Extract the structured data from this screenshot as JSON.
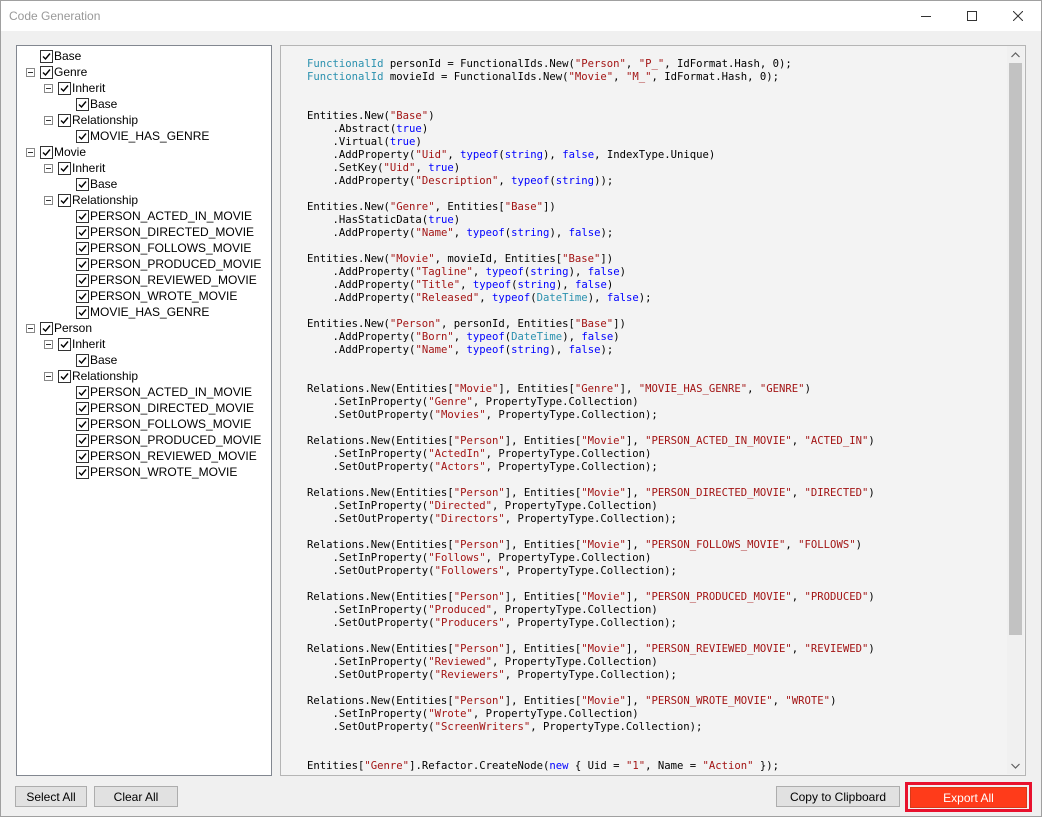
{
  "window": {
    "title": "Code Generation",
    "controls": [
      "minimize-icon",
      "maximize-icon",
      "close-icon"
    ]
  },
  "tree": [
    {
      "label": "Base",
      "checked": true,
      "expander": false
    },
    {
      "label": "Genre",
      "checked": true,
      "expander": true
    },
    {
      "label": "Inherit",
      "checked": true,
      "expander": true
    },
    {
      "label": "Base",
      "checked": true,
      "expander": false
    },
    {
      "label": "Relationship",
      "checked": true,
      "expander": true
    },
    {
      "label": "MOVIE_HAS_GENRE",
      "checked": true,
      "expander": false
    },
    {
      "label": "Movie",
      "checked": true,
      "expander": true
    },
    {
      "label": "Inherit",
      "checked": true,
      "expander": true
    },
    {
      "label": "Base",
      "checked": true,
      "expander": false
    },
    {
      "label": "Relationship",
      "checked": true,
      "expander": true
    },
    {
      "label": "PERSON_ACTED_IN_MOVIE",
      "checked": true,
      "expander": false
    },
    {
      "label": "PERSON_DIRECTED_MOVIE",
      "checked": true,
      "expander": false
    },
    {
      "label": "PERSON_FOLLOWS_MOVIE",
      "checked": true,
      "expander": false
    },
    {
      "label": "PERSON_PRODUCED_MOVIE",
      "checked": true,
      "expander": false
    },
    {
      "label": "PERSON_REVIEWED_MOVIE",
      "checked": true,
      "expander": false
    },
    {
      "label": "PERSON_WROTE_MOVIE",
      "checked": true,
      "expander": false
    },
    {
      "label": "MOVIE_HAS_GENRE",
      "checked": true,
      "expander": false
    },
    {
      "label": "Person",
      "checked": true,
      "expander": true
    },
    {
      "label": "Inherit",
      "checked": true,
      "expander": true
    },
    {
      "label": "Base",
      "checked": true,
      "expander": false
    },
    {
      "label": "Relationship",
      "checked": true,
      "expander": true
    },
    {
      "label": "PERSON_ACTED_IN_MOVIE",
      "checked": true,
      "expander": false
    },
    {
      "label": "PERSON_DIRECTED_MOVIE",
      "checked": true,
      "expander": false
    },
    {
      "label": "PERSON_FOLLOWS_MOVIE",
      "checked": true,
      "expander": false
    },
    {
      "label": "PERSON_PRODUCED_MOVIE",
      "checked": true,
      "expander": false
    },
    {
      "label": "PERSON_REVIEWED_MOVIE",
      "checked": true,
      "expander": false
    },
    {
      "label": "PERSON_WROTE_MOVIE",
      "checked": true,
      "expander": false
    }
  ],
  "code_colors": {
    "type": "#2b91af",
    "string": "#a31515",
    "keyword": "#0000ff",
    "default": "#000000"
  },
  "code": [
    [
      [
        "t",
        "FunctionalId"
      ],
      [
        "p",
        " personId = FunctionalIds.New("
      ],
      [
        "s",
        "\"Person\""
      ],
      [
        "p",
        ", "
      ],
      [
        "s",
        "\"P_\""
      ],
      [
        "p",
        ", IdFormat.Hash, 0);"
      ]
    ],
    [
      [
        "t",
        "FunctionalId"
      ],
      [
        "p",
        " movieId = FunctionalIds.New("
      ],
      [
        "s",
        "\"Movie\""
      ],
      [
        "p",
        ", "
      ],
      [
        "s",
        "\"M_\""
      ],
      [
        "p",
        ", IdFormat.Hash, 0);"
      ]
    ],
    [],
    [],
    [
      [
        "p",
        "Entities.New("
      ],
      [
        "s",
        "\"Base\""
      ],
      [
        "p",
        ")"
      ]
    ],
    [
      [
        "p",
        "    .Abstract("
      ],
      [
        "k",
        "true"
      ],
      [
        "p",
        ")"
      ]
    ],
    [
      [
        "p",
        "    .Virtual("
      ],
      [
        "k",
        "true"
      ],
      [
        "p",
        ")"
      ]
    ],
    [
      [
        "p",
        "    .AddProperty("
      ],
      [
        "s",
        "\"Uid\""
      ],
      [
        "p",
        ", "
      ],
      [
        "k",
        "typeof"
      ],
      [
        "p",
        "("
      ],
      [
        "k",
        "string"
      ],
      [
        "p",
        "), "
      ],
      [
        "k",
        "false"
      ],
      [
        "p",
        ", IndexType.Unique)"
      ]
    ],
    [
      [
        "p",
        "    .SetKey("
      ],
      [
        "s",
        "\"Uid\""
      ],
      [
        "p",
        ", "
      ],
      [
        "k",
        "true"
      ],
      [
        "p",
        ")"
      ]
    ],
    [
      [
        "p",
        "    .AddProperty("
      ],
      [
        "s",
        "\"Description\""
      ],
      [
        "p",
        ", "
      ],
      [
        "k",
        "typeof"
      ],
      [
        "p",
        "("
      ],
      [
        "k",
        "string"
      ],
      [
        "p",
        "));"
      ]
    ],
    [],
    [
      [
        "p",
        "Entities.New("
      ],
      [
        "s",
        "\"Genre\""
      ],
      [
        "p",
        ", Entities["
      ],
      [
        "s",
        "\"Base\""
      ],
      [
        "p",
        "])"
      ]
    ],
    [
      [
        "p",
        "    .HasStaticData("
      ],
      [
        "k",
        "true"
      ],
      [
        "p",
        ")"
      ]
    ],
    [
      [
        "p",
        "    .AddProperty("
      ],
      [
        "s",
        "\"Name\""
      ],
      [
        "p",
        ", "
      ],
      [
        "k",
        "typeof"
      ],
      [
        "p",
        "("
      ],
      [
        "k",
        "string"
      ],
      [
        "p",
        "), "
      ],
      [
        "k",
        "false"
      ],
      [
        "p",
        ");"
      ]
    ],
    [],
    [
      [
        "p",
        "Entities.New("
      ],
      [
        "s",
        "\"Movie\""
      ],
      [
        "p",
        ", movieId, Entities["
      ],
      [
        "s",
        "\"Base\""
      ],
      [
        "p",
        "])"
      ]
    ],
    [
      [
        "p",
        "    .AddProperty("
      ],
      [
        "s",
        "\"Tagline\""
      ],
      [
        "p",
        ", "
      ],
      [
        "k",
        "typeof"
      ],
      [
        "p",
        "("
      ],
      [
        "k",
        "string"
      ],
      [
        "p",
        "), "
      ],
      [
        "k",
        "false"
      ],
      [
        "p",
        ")"
      ]
    ],
    [
      [
        "p",
        "    .AddProperty("
      ],
      [
        "s",
        "\"Title\""
      ],
      [
        "p",
        ", "
      ],
      [
        "k",
        "typeof"
      ],
      [
        "p",
        "("
      ],
      [
        "k",
        "string"
      ],
      [
        "p",
        "), "
      ],
      [
        "k",
        "false"
      ],
      [
        "p",
        ")"
      ]
    ],
    [
      [
        "p",
        "    .AddProperty("
      ],
      [
        "s",
        "\"Released\""
      ],
      [
        "p",
        ", "
      ],
      [
        "k",
        "typeof"
      ],
      [
        "p",
        "("
      ],
      [
        "t",
        "DateTime"
      ],
      [
        "p",
        "), "
      ],
      [
        "k",
        "false"
      ],
      [
        "p",
        ");"
      ]
    ],
    [],
    [
      [
        "p",
        "Entities.New("
      ],
      [
        "s",
        "\"Person\""
      ],
      [
        "p",
        ", personId, Entities["
      ],
      [
        "s",
        "\"Base\""
      ],
      [
        "p",
        "])"
      ]
    ],
    [
      [
        "p",
        "    .AddProperty("
      ],
      [
        "s",
        "\"Born\""
      ],
      [
        "p",
        ", "
      ],
      [
        "k",
        "typeof"
      ],
      [
        "p",
        "("
      ],
      [
        "t",
        "DateTime"
      ],
      [
        "p",
        "), "
      ],
      [
        "k",
        "false"
      ],
      [
        "p",
        ")"
      ]
    ],
    [
      [
        "p",
        "    .AddProperty("
      ],
      [
        "s",
        "\"Name\""
      ],
      [
        "p",
        ", "
      ],
      [
        "k",
        "typeof"
      ],
      [
        "p",
        "("
      ],
      [
        "k",
        "string"
      ],
      [
        "p",
        "), "
      ],
      [
        "k",
        "false"
      ],
      [
        "p",
        ");"
      ]
    ],
    [],
    [],
    [
      [
        "p",
        "Relations.New(Entities["
      ],
      [
        "s",
        "\"Movie\""
      ],
      [
        "p",
        "], Entities["
      ],
      [
        "s",
        "\"Genre\""
      ],
      [
        "p",
        "], "
      ],
      [
        "s",
        "\"MOVIE_HAS_GENRE\""
      ],
      [
        "p",
        ", "
      ],
      [
        "s",
        "\"GENRE\""
      ],
      [
        "p",
        ")"
      ]
    ],
    [
      [
        "p",
        "    .SetInProperty("
      ],
      [
        "s",
        "\"Genre\""
      ],
      [
        "p",
        ", PropertyType.Collection)"
      ]
    ],
    [
      [
        "p",
        "    .SetOutProperty("
      ],
      [
        "s",
        "\"Movies\""
      ],
      [
        "p",
        ", PropertyType.Collection);"
      ]
    ],
    [],
    [
      [
        "p",
        "Relations.New(Entities["
      ],
      [
        "s",
        "\"Person\""
      ],
      [
        "p",
        "], Entities["
      ],
      [
        "s",
        "\"Movie\""
      ],
      [
        "p",
        "], "
      ],
      [
        "s",
        "\"PERSON_ACTED_IN_MOVIE\""
      ],
      [
        "p",
        ", "
      ],
      [
        "s",
        "\"ACTED_IN\""
      ],
      [
        "p",
        ")"
      ]
    ],
    [
      [
        "p",
        "    .SetInProperty("
      ],
      [
        "s",
        "\"ActedIn\""
      ],
      [
        "p",
        ", PropertyType.Collection)"
      ]
    ],
    [
      [
        "p",
        "    .SetOutProperty("
      ],
      [
        "s",
        "\"Actors\""
      ],
      [
        "p",
        ", PropertyType.Collection);"
      ]
    ],
    [],
    [
      [
        "p",
        "Relations.New(Entities["
      ],
      [
        "s",
        "\"Person\""
      ],
      [
        "p",
        "], Entities["
      ],
      [
        "s",
        "\"Movie\""
      ],
      [
        "p",
        "], "
      ],
      [
        "s",
        "\"PERSON_DIRECTED_MOVIE\""
      ],
      [
        "p",
        ", "
      ],
      [
        "s",
        "\"DIRECTED\""
      ],
      [
        "p",
        ")"
      ]
    ],
    [
      [
        "p",
        "    .SetInProperty("
      ],
      [
        "s",
        "\"Directed\""
      ],
      [
        "p",
        ", PropertyType.Collection)"
      ]
    ],
    [
      [
        "p",
        "    .SetOutProperty("
      ],
      [
        "s",
        "\"Directors\""
      ],
      [
        "p",
        ", PropertyType.Collection);"
      ]
    ],
    [],
    [
      [
        "p",
        "Relations.New(Entities["
      ],
      [
        "s",
        "\"Person\""
      ],
      [
        "p",
        "], Entities["
      ],
      [
        "s",
        "\"Movie\""
      ],
      [
        "p",
        "], "
      ],
      [
        "s",
        "\"PERSON_FOLLOWS_MOVIE\""
      ],
      [
        "p",
        ", "
      ],
      [
        "s",
        "\"FOLLOWS\""
      ],
      [
        "p",
        ")"
      ]
    ],
    [
      [
        "p",
        "    .SetInProperty("
      ],
      [
        "s",
        "\"Follows\""
      ],
      [
        "p",
        ", PropertyType.Collection)"
      ]
    ],
    [
      [
        "p",
        "    .SetOutProperty("
      ],
      [
        "s",
        "\"Followers\""
      ],
      [
        "p",
        ", PropertyType.Collection);"
      ]
    ],
    [],
    [
      [
        "p",
        "Relations.New(Entities["
      ],
      [
        "s",
        "\"Person\""
      ],
      [
        "p",
        "], Entities["
      ],
      [
        "s",
        "\"Movie\""
      ],
      [
        "p",
        "], "
      ],
      [
        "s",
        "\"PERSON_PRODUCED_MOVIE\""
      ],
      [
        "p",
        ", "
      ],
      [
        "s",
        "\"PRODUCED\""
      ],
      [
        "p",
        ")"
      ]
    ],
    [
      [
        "p",
        "    .SetInProperty("
      ],
      [
        "s",
        "\"Produced\""
      ],
      [
        "p",
        ", PropertyType.Collection)"
      ]
    ],
    [
      [
        "p",
        "    .SetOutProperty("
      ],
      [
        "s",
        "\"Producers\""
      ],
      [
        "p",
        ", PropertyType.Collection);"
      ]
    ],
    [],
    [
      [
        "p",
        "Relations.New(Entities["
      ],
      [
        "s",
        "\"Person\""
      ],
      [
        "p",
        "], Entities["
      ],
      [
        "s",
        "\"Movie\""
      ],
      [
        "p",
        "], "
      ],
      [
        "s",
        "\"PERSON_REVIEWED_MOVIE\""
      ],
      [
        "p",
        ", "
      ],
      [
        "s",
        "\"REVIEWED\""
      ],
      [
        "p",
        ")"
      ]
    ],
    [
      [
        "p",
        "    .SetInProperty("
      ],
      [
        "s",
        "\"Reviewed\""
      ],
      [
        "p",
        ", PropertyType.Collection)"
      ]
    ],
    [
      [
        "p",
        "    .SetOutProperty("
      ],
      [
        "s",
        "\"Reviewers\""
      ],
      [
        "p",
        ", PropertyType.Collection);"
      ]
    ],
    [],
    [
      [
        "p",
        "Relations.New(Entities["
      ],
      [
        "s",
        "\"Person\""
      ],
      [
        "p",
        "], Entities["
      ],
      [
        "s",
        "\"Movie\""
      ],
      [
        "p",
        "], "
      ],
      [
        "s",
        "\"PERSON_WROTE_MOVIE\""
      ],
      [
        "p",
        ", "
      ],
      [
        "s",
        "\"WROTE\""
      ],
      [
        "p",
        ")"
      ]
    ],
    [
      [
        "p",
        "    .SetInProperty("
      ],
      [
        "s",
        "\"Wrote\""
      ],
      [
        "p",
        ", PropertyType.Collection)"
      ]
    ],
    [
      [
        "p",
        "    .SetOutProperty("
      ],
      [
        "s",
        "\"ScreenWriters\""
      ],
      [
        "p",
        ", PropertyType.Collection);"
      ]
    ],
    [],
    [],
    [
      [
        "p",
        "Entities["
      ],
      [
        "s",
        "\"Genre\""
      ],
      [
        "p",
        "].Refactor.CreateNode("
      ],
      [
        "k",
        "new"
      ],
      [
        "p",
        " { Uid = "
      ],
      [
        "s",
        "\"1\""
      ],
      [
        "p",
        ", Name = "
      ],
      [
        "s",
        "\"Action\""
      ],
      [
        "p",
        " });"
      ]
    ]
  ],
  "buttons": {
    "select_all": "Select All",
    "clear_all": "Clear All",
    "copy_clipboard": "Copy to Clipboard",
    "export_all": "Export All"
  },
  "accent": {
    "export_fill": "#ff3b1a",
    "highlight_frame": "#e8112d"
  }
}
